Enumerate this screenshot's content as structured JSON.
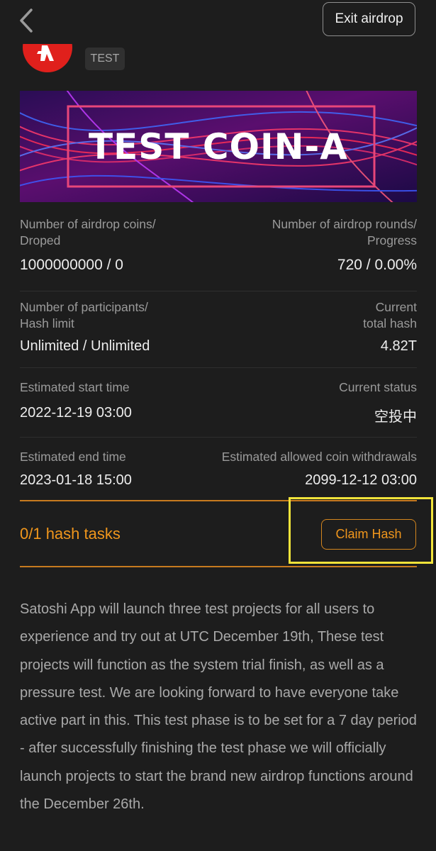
{
  "header": {
    "back_icon": "chevron-left-icon",
    "exit_label": "Exit airdrop"
  },
  "project": {
    "logo_icon": "brand-logo-icon",
    "tag": "TEST",
    "banner_title": "TEST COIN-A"
  },
  "stats": {
    "coins_label_1": "Number of airdrop coins/",
    "coins_label_2": "Droped",
    "coins_value": "1000000000 / 0",
    "rounds_label_1": "Number of airdrop rounds/",
    "rounds_label_2": "Progress",
    "rounds_value": "720 / 0.00%",
    "participants_label_1": "Number of participants/",
    "participants_label_2": "Hash limit",
    "participants_value": "Unlimited / Unlimited",
    "hash_label_1": "Current",
    "hash_label_2": "total hash",
    "hash_value": "4.82T",
    "start_label": "Estimated start time",
    "start_value": "2022-12-19 03:00",
    "status_label": "Current status",
    "status_value": "空投中",
    "end_label": "Estimated end time",
    "end_value": "2023-01-18 15:00",
    "withdraw_label": "Estimated allowed coin withdrawals",
    "withdraw_value": "2099-12-12 03:00"
  },
  "tasks": {
    "label": "0/1 hash tasks",
    "claim_label": "Claim Hash"
  },
  "description": "Satoshi App will launch three test projects for all users to experience and try out at UTC December 19th,  These test projects will function as the system trial finish, as well as a pressure test. We are looking forward to have everyone take active part in this. This test phase is to be set for a 7 day period - after successfully finishing the test phase we will officially launch projects to start the brand new airdrop functions around the December 26th.",
  "colors": {
    "background": "#1d1d1d",
    "accent_orange": "#f0961c",
    "highlight_yellow": "#f1e33a",
    "logo_red": "#e0201c"
  }
}
